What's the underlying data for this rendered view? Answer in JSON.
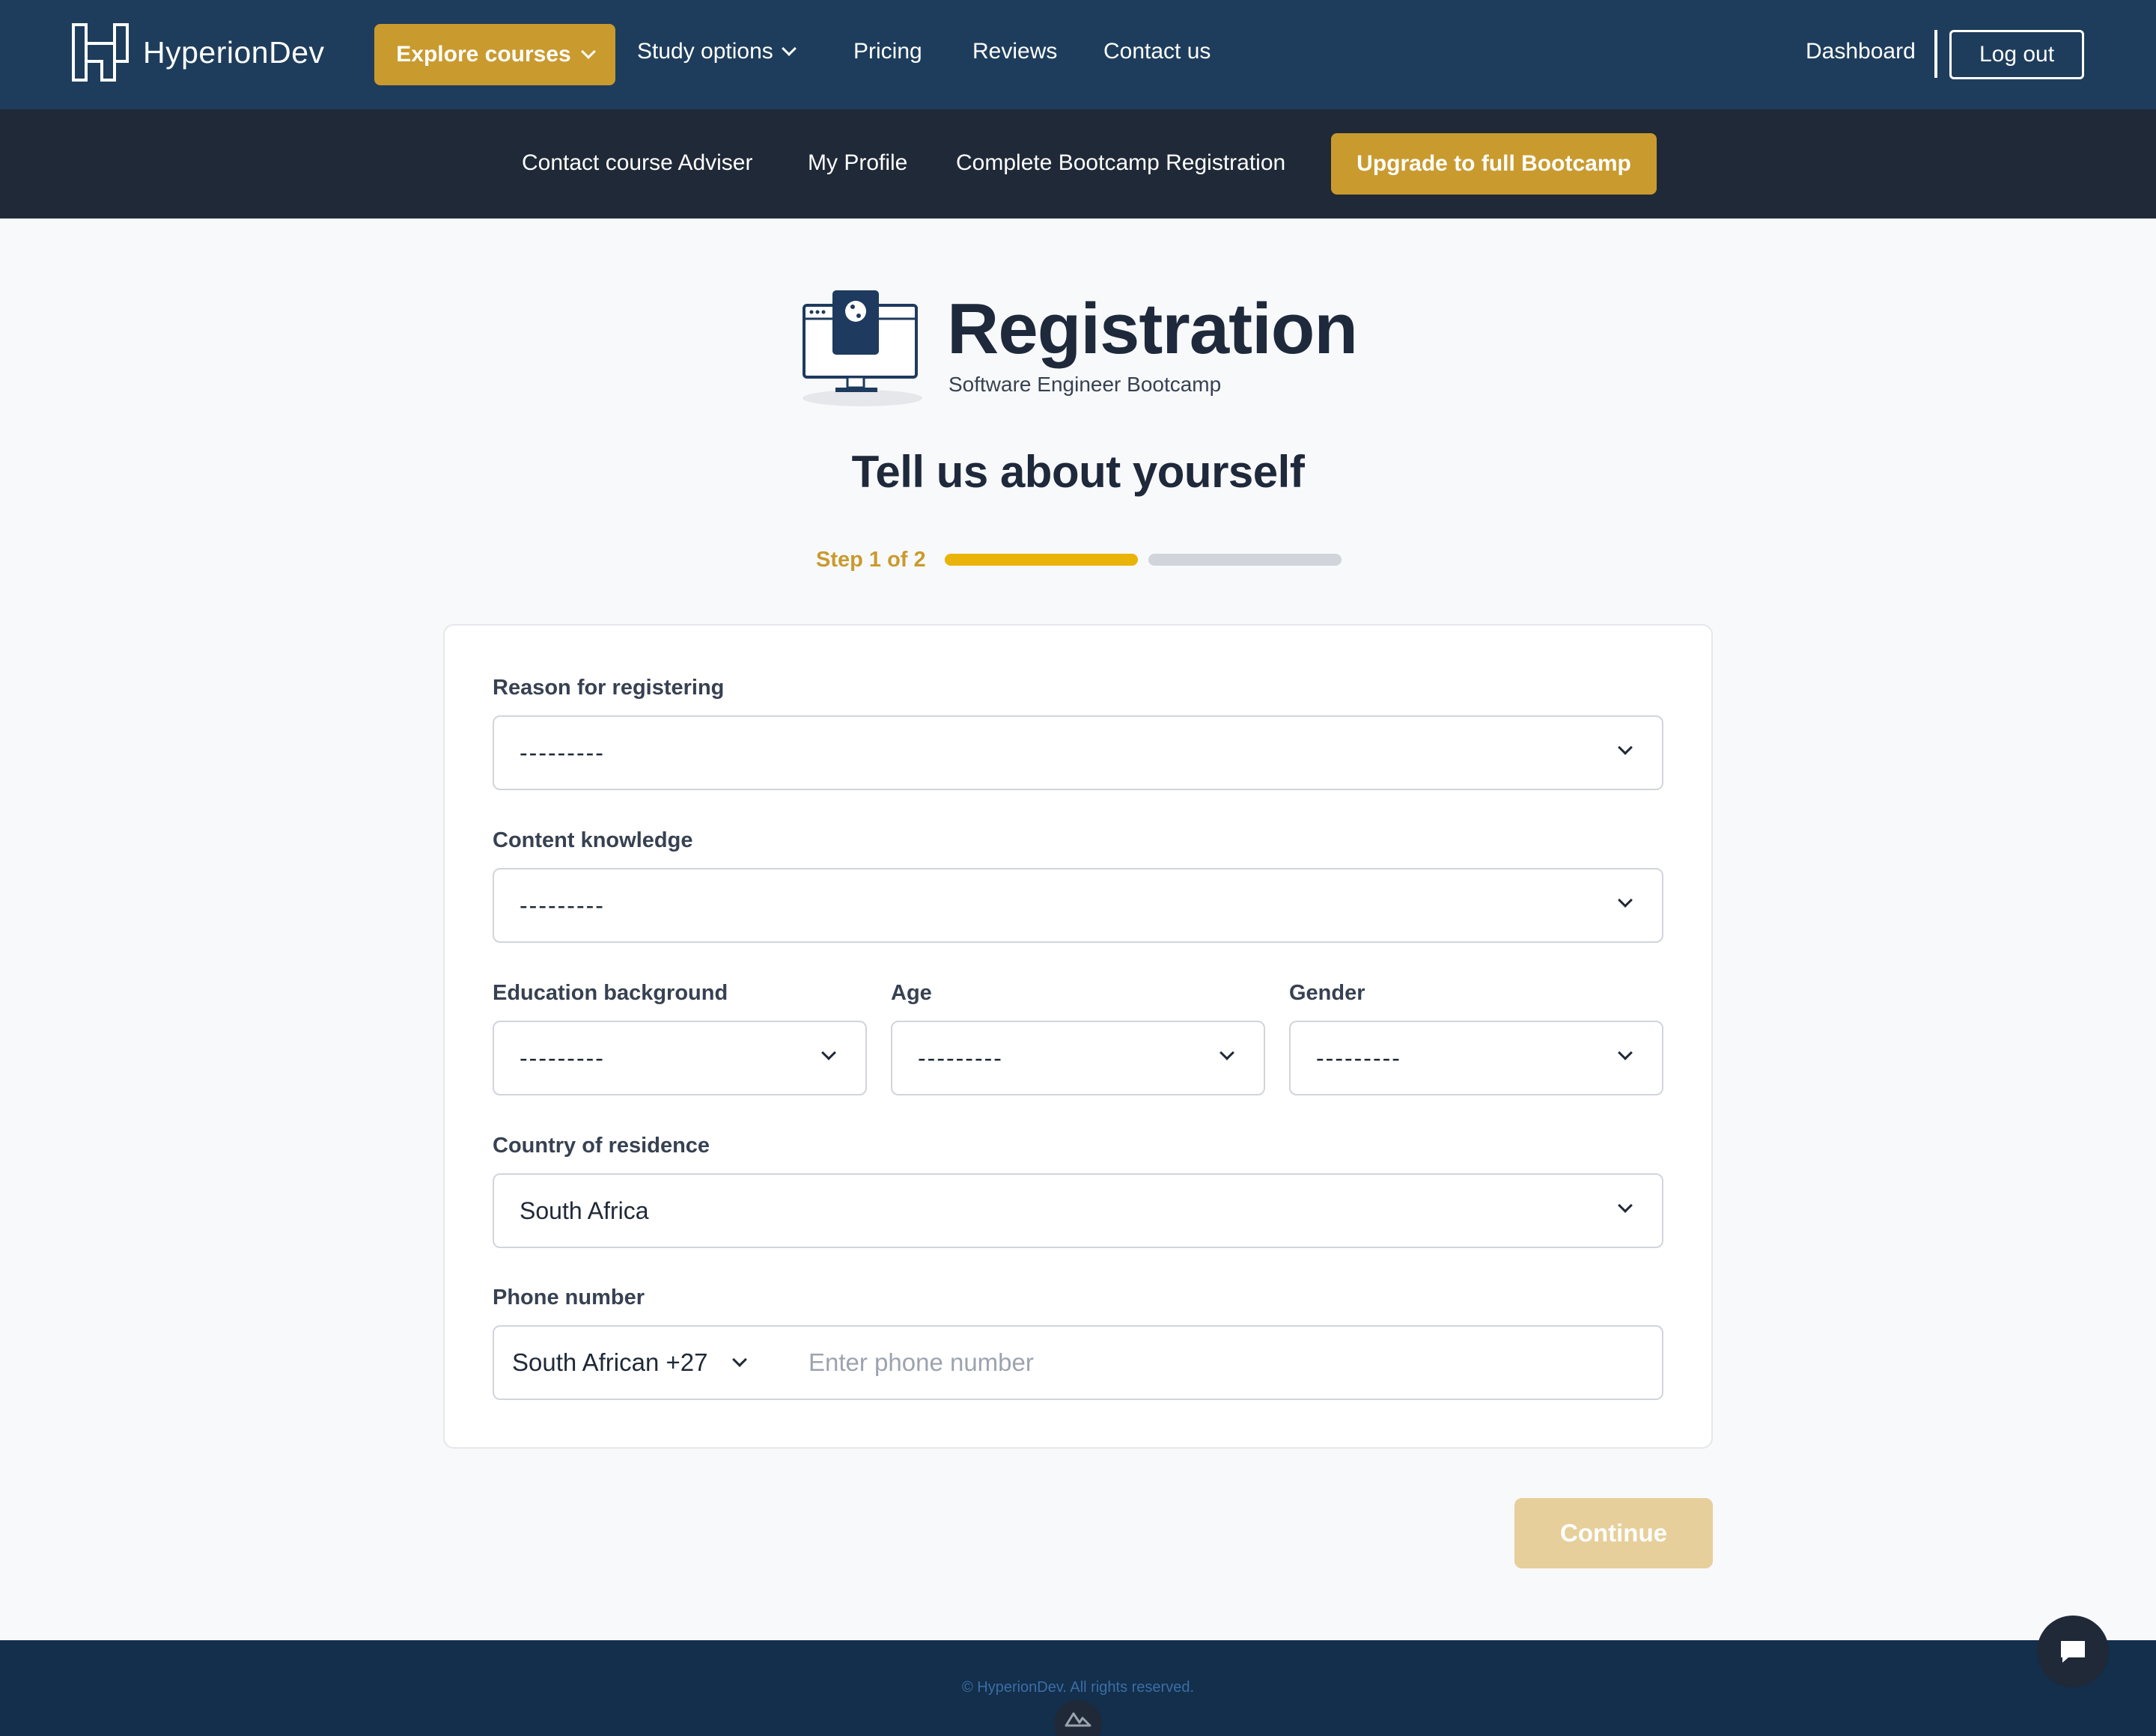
{
  "brand": {
    "name": "HyperionDev",
    "gold": "#c99a2e",
    "navy": "#1e3d5c"
  },
  "topnav": {
    "explore": "Explore courses",
    "study": "Study options",
    "pricing": "Pricing",
    "reviews": "Reviews",
    "contact": "Contact us",
    "dashboard": "Dashboard",
    "logout": "Log out"
  },
  "subnav": {
    "adviser": "Contact course Adviser",
    "profile": "My Profile",
    "complete": "Complete Bootcamp Registration",
    "upgrade": "Upgrade to full Bootcamp"
  },
  "header": {
    "title": "Registration",
    "subtitle": "Software Engineer Bootcamp",
    "heading": "Tell us about yourself",
    "step": "Step 1 of 2",
    "step_current": 1,
    "step_total": 2
  },
  "form": {
    "reason": {
      "label": "Reason for registering",
      "value": "---------"
    },
    "knowledge": {
      "label": "Content knowledge",
      "value": "---------"
    },
    "education": {
      "label": "Education background",
      "value": "---------"
    },
    "age": {
      "label": "Age",
      "value": "---------"
    },
    "gender": {
      "label": "Gender",
      "value": "---------"
    },
    "country": {
      "label": "Country of residence",
      "value": "South Africa"
    },
    "phone": {
      "label": "Phone number",
      "code": "South African +27",
      "placeholder": "Enter phone number"
    }
  },
  "actions": {
    "continue": "Continue"
  },
  "footer": {
    "copyright": "© HyperionDev. All rights reserved."
  },
  "icons": [
    "hyperiondev-logo-icon",
    "chevron-down-icon",
    "monitor-python-icon",
    "chat-icon",
    "nuxt-icon"
  ]
}
